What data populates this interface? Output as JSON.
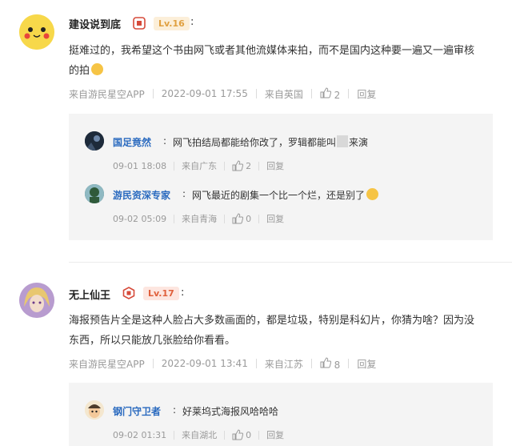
{
  "comments": [
    {
      "user": "建设说到底",
      "level": "Lv.16",
      "text_line1": "挺难过的，我希望这个书由网飞或者其他流媒体来拍，而不是国内这种要一遍又一遍审核",
      "text_line2": "的拍",
      "source": "来自游民星空APP",
      "time": "2022-09-01 17:55",
      "location": "来自英国",
      "likes": "2",
      "reply_label": "回复",
      "replies": [
        {
          "user": "国足竟然",
          "text_before": "网飞拍结局都能给你改了，罗辑都能叫",
          "text_after": "来演",
          "time": "09-01 18:08",
          "location": "来自广东",
          "likes": "2",
          "reply_label": "回复"
        },
        {
          "user": "游民资深专家",
          "text": "网飞最近的剧集一个比一个烂，还是别了",
          "time": "09-02 05:09",
          "location": "来自青海",
          "likes": "0",
          "reply_label": "回复"
        }
      ]
    },
    {
      "user": "无上仙王",
      "level": "Lv.17",
      "text_line1": "海报预告片全是这种人脸占大多数画面的，都是垃圾，特别是科幻片，你猜为啥？因为没",
      "text_line2": "东西，所以只能放几张脸给你看看。",
      "source": "来自游民星空APP",
      "time": "2022-09-01 13:41",
      "location": "来自江苏",
      "likes": "8",
      "reply_label": "回复",
      "replies": [
        {
          "user": "钢门守卫者",
          "text": "好莱坞式海报风哈哈哈",
          "time": "09-02 01:31",
          "location": "来自湖北",
          "likes": "0",
          "reply_label": "回复"
        }
      ]
    }
  ],
  "colors": {
    "level_bg_1": "#fcefd9",
    "level_fg_1": "#e0a040",
    "level_bg_2": "#fde6e0",
    "level_fg_2": "#e0603c",
    "reply_name": "#2a6abf",
    "badge_red": "#d64a3a"
  }
}
